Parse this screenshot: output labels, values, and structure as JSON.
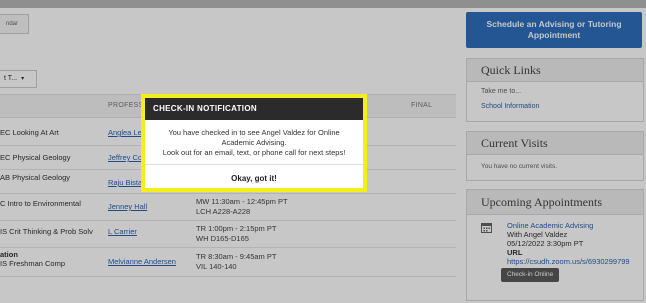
{
  "header": {
    "tab_partial": "ndar",
    "select_partial": "t T..."
  },
  "table": {
    "columns": [
      "PROFESSOR",
      "FINAL"
    ],
    "rows": [
      {
        "course": "EC Looking At Art",
        "professor": "Anglea Le",
        "time": "",
        "room": ""
      },
      {
        "course": "EC Physical Geology",
        "professor": "Jeffrey Co",
        "time": "",
        "room": ""
      },
      {
        "course": "AB Physical Geology",
        "professor": "Raju Bista",
        "time": "",
        "room": ""
      },
      {
        "course": "C Intro to Environmental",
        "professor": "Jenney Hall",
        "time": "MW 11:30am - 12:45pm PT",
        "room": "LCH A228-A228"
      },
      {
        "course": "IS Crit Thinking & Prob Solv",
        "professor": "L Carrier",
        "time": "TR 1:00pm - 2:15pm PT",
        "room": "WH D165-D165"
      },
      {
        "course_bold": "ation",
        "course": "IS Freshman Comp",
        "professor": "Melvianne Andersen",
        "time": "TR 8:30am - 9:45am PT",
        "room": "VIL 140-140"
      }
    ]
  },
  "sidebar": {
    "schedule_button": "Schedule an Advising or Tutoring Appointment",
    "quick_links": {
      "title": "Quick Links",
      "items": [
        "Take me to...",
        "School Information"
      ]
    },
    "current_visits": {
      "title": "Current Visits",
      "empty": "You have no current visits."
    },
    "upcoming": {
      "title": "Upcoming Appointments",
      "appt_title": "Online Academic Advising",
      "with": "With Angel Valdez",
      "datetime": "05/12/2022 3:30pm PT",
      "url_label": "URL",
      "url": "https://csudh.zoom.us/s/6930299799",
      "checkin_button": "Check-in Online"
    }
  },
  "modal": {
    "title": "CHECK-IN NOTIFICATION",
    "line1": "You have checked in to see Angel Valdez for Online Academic Advising.",
    "line2": "Look out for an email, text, or phone call for next steps!",
    "button": "Okay, got it!"
  },
  "colors": {
    "accent": "#2d6fbb",
    "highlight": "#f4ef1a",
    "modal_header": "#2b2b2b",
    "link": "#2a62b0"
  }
}
